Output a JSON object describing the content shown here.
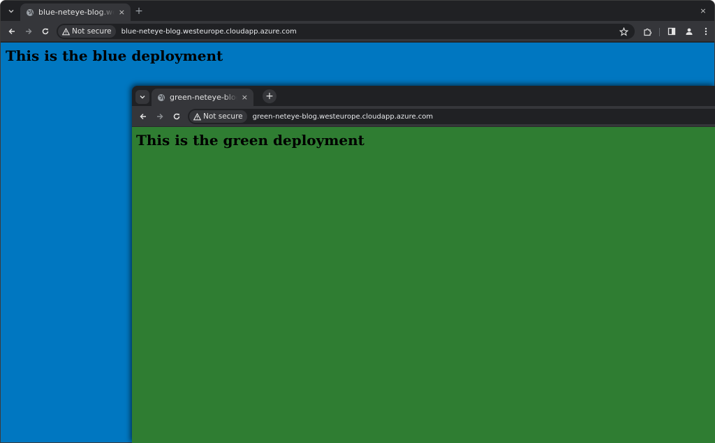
{
  "blue_window": {
    "tab": {
      "title": "blue-neteye-blog.westeurope.cloudapp.azure.com",
      "close": "×"
    },
    "new_tab": "+",
    "window_close": "×",
    "security_chip": "Not secure",
    "url": "blue-neteye-blog.westeurope.cloudapp.azure.com",
    "heading": "This is the blue deployment",
    "page_background": "#0077c1"
  },
  "green_window": {
    "tab": {
      "title": "green-neteye-blog.westeurope.cloudapp.azure.com",
      "close": "×"
    },
    "new_tab": "+",
    "security_chip": "Not secure",
    "url": "green-neteye-blog.westeurope.cloudapp.azure.com",
    "heading": "This is the green deployment",
    "page_background": "#2f7d32"
  },
  "icons": {
    "tab_search": "chevron-down-icon",
    "favicon": "globe-icon",
    "back": "arrow-left-icon",
    "forward": "arrow-right-icon",
    "reload": "reload-icon",
    "security": "warning-triangle-icon",
    "bookmark": "star-icon",
    "extensions": "puzzle-icon",
    "side_panel": "side-panel-icon",
    "profile": "person-icon",
    "menu": "kebab-menu-icon"
  },
  "colors": {
    "chrome_dark": "#202124",
    "toolbar": "#35363a",
    "text": "#e3e3e3"
  }
}
